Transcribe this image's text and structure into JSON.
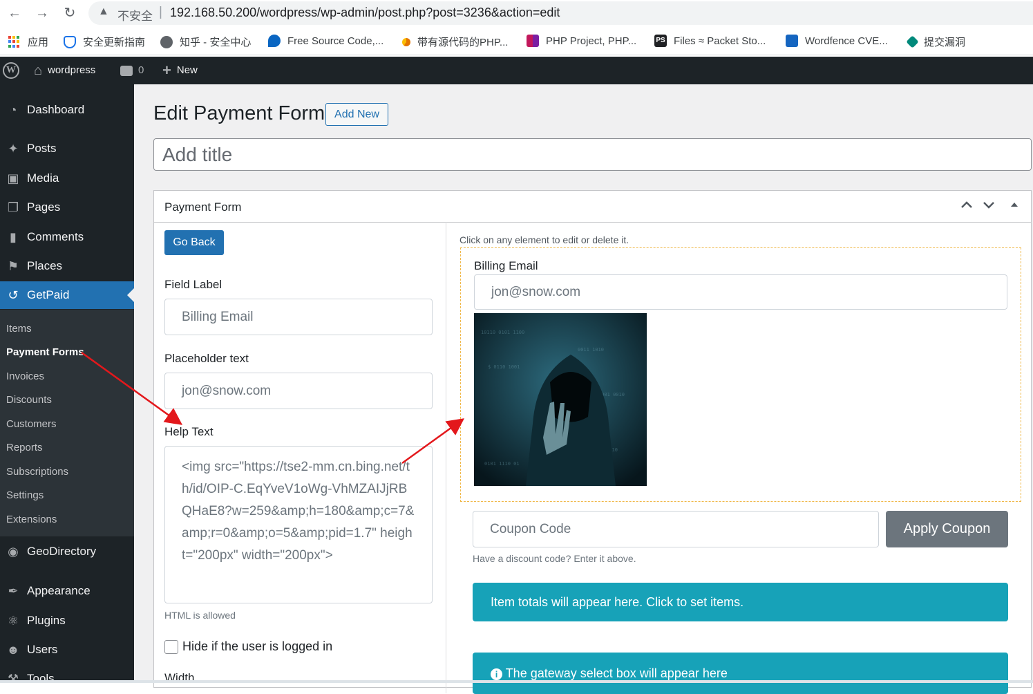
{
  "browser": {
    "insecure_label": "不安全",
    "url": "192.168.50.200/wordpress/wp-admin/post.php?post=3236&action=edit",
    "bookmarks": [
      {
        "label": "应用",
        "color": "#ea4335"
      },
      {
        "label": "安全更新指南",
        "color": "#1a73e8"
      },
      {
        "label": "知乎 - 安全中心",
        "color": "#5f6368"
      },
      {
        "label": "Free Source Code,...",
        "color": "#0a66c2"
      },
      {
        "label": "带有源代码的PHP...",
        "color": "#e37400"
      },
      {
        "label": "PHP Project, PHP...",
        "color": "#c2185b"
      },
      {
        "label": "Files ≈ Packet Sto...",
        "color": "#202124"
      },
      {
        "label": "Wordfence CVE...",
        "color": "#1565c0"
      },
      {
        "label": "提交漏洞",
        "color": "#00897b"
      }
    ]
  },
  "adminbar": {
    "site_name": "wordpress",
    "comments_count": "0",
    "new_label": "New"
  },
  "sidebar": {
    "items": [
      {
        "label": "Dashboard",
        "icon": "dashboard-icon"
      },
      {
        "label": "Posts",
        "icon": "pin-icon"
      },
      {
        "label": "Media",
        "icon": "media-icon"
      },
      {
        "label": "Pages",
        "icon": "pages-icon"
      },
      {
        "label": "Comments",
        "icon": "comment-icon"
      },
      {
        "label": "Places",
        "icon": "places-icon"
      },
      {
        "label": "GetPaid",
        "icon": "getpaid-icon"
      },
      {
        "label": "GeoDirectory",
        "icon": "wordpress-icon"
      },
      {
        "label": "Appearance",
        "icon": "brush-icon"
      },
      {
        "label": "Plugins",
        "icon": "plug-icon"
      },
      {
        "label": "Users",
        "icon": "user-icon"
      },
      {
        "label": "Tools",
        "icon": "wrench-icon"
      }
    ],
    "submenu": [
      "Items",
      "Payment Forms",
      "Invoices",
      "Discounts",
      "Customers",
      "Reports",
      "Subscriptions",
      "Settings",
      "Extensions"
    ]
  },
  "main": {
    "page_title": "Edit Payment Form",
    "add_new": "Add New",
    "title_placeholder": "Add title",
    "postbox_title": "Payment Form",
    "go_back": "Go Back",
    "field_label_heading": "Field Label",
    "field_label_value": "Billing Email",
    "placeholder_heading": "Placeholder text",
    "placeholder_value": "jon@snow.com",
    "help_text_heading": "Help Text",
    "help_text_value": "<img src=\"https://tse2-mm.cn.bing.net/th/id/OIP-C.EqYveV1oWg-VhMZAIJjRBQHaE8?w=259&amp;h=180&amp;c=7&amp;r=0&amp;o=5&amp;pid=1.7\" height=\"200px\" width=\"200px\">",
    "html_allowed": "HTML is allowed",
    "hide_logged_in": "Hide if the user is logged in",
    "width_label": "Width",
    "preview_hint": "Click on any element to edit or delete it.",
    "preview_label": "Billing Email",
    "preview_placeholder": "jon@snow.com",
    "coupon_placeholder": "Coupon Code",
    "apply_coupon": "Apply Coupon",
    "coupon_hint": "Have a discount code? Enter it above.",
    "item_totals": "Item totals will appear here. Click to set items.",
    "gateway_text": "The gateway select box will appear here"
  },
  "colors": {
    "wp_dark": "#1d2327",
    "wp_blue": "#2271b1",
    "alert_teal": "#17a2b8",
    "annotation_red": "#e3181c"
  }
}
